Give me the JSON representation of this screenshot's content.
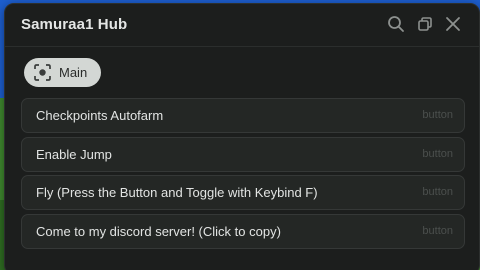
{
  "window": {
    "title": "Samuraa1 Hub"
  },
  "titlebar_icons": [
    "search-icon",
    "minimize-icon",
    "close-icon"
  ],
  "tabs": [
    {
      "label": "Main",
      "icon": "scan-icon",
      "selected": true
    }
  ],
  "buttons": [
    {
      "label": "Checkpoints Autofarm",
      "hint": "button"
    },
    {
      "label": "Enable Jump",
      "hint": "button"
    },
    {
      "label": "Fly (Press the Button and Toggle with Keybind F)",
      "hint": "button"
    },
    {
      "label": "Come to my discord server! (Click to copy)",
      "hint": "button"
    }
  ],
  "colors": {
    "window_bg": "#1c1e1d",
    "row_bg": "#242725",
    "tab_bg": "#d3d7d4",
    "text": "#e2e4e3",
    "hint": "#4b4f4d"
  }
}
